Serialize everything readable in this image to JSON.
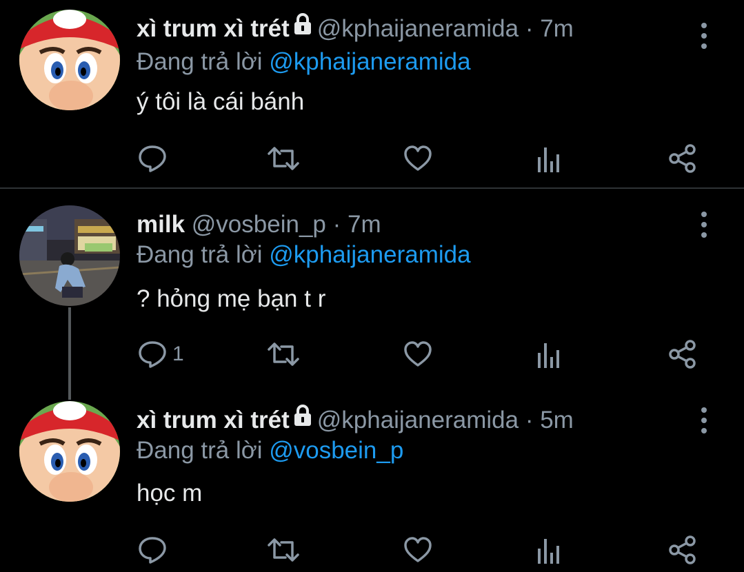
{
  "tweets": [
    {
      "name": "xì trum xì trét",
      "handle": "@kphaijaneramida",
      "dot": "·",
      "time": "7m",
      "reply_prefix": "Đang trả lời",
      "reply_to": "@kphaijaneramida",
      "text": "ý tôi là cái bánh",
      "reply_count": "",
      "avatar": "mario-avatar",
      "locked": true
    },
    {
      "name": "milk",
      "handle": "@vosbein_p",
      "dot": "·",
      "time": "7m",
      "reply_prefix": "Đang trả lời",
      "reply_to": "@kphaijaneramida",
      "text": "? hỏng mẹ bạn t r",
      "reply_count": "1",
      "avatar": "street-photo-avatar",
      "locked": false
    },
    {
      "name": "xì trum xì trét",
      "handle": "@kphaijaneramida",
      "dot": "·",
      "time": "5m",
      "reply_prefix": "Đang trả lời",
      "reply_to": "@vosbein_p",
      "text": "học m",
      "reply_count": "",
      "avatar": "mario-avatar",
      "locked": true
    }
  ],
  "colors": {
    "background": "#000000",
    "text": "#e7e9ea",
    "muted": "#8b98a5",
    "accent": "#1d9bf0",
    "divider": "#2f3336"
  },
  "icons": [
    "reply-icon",
    "retweet-icon",
    "like-icon",
    "analytics-icon",
    "share-icon",
    "more-icon",
    "lock-icon"
  ]
}
